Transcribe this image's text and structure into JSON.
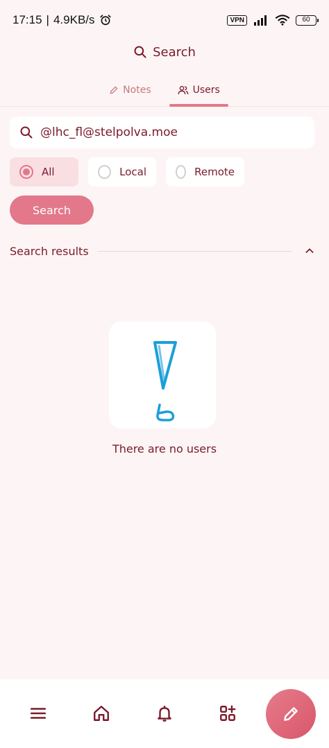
{
  "status_bar": {
    "time": "17:15",
    "separator": "|",
    "net_speed": "4.9KB/s",
    "vpn": "VPN",
    "battery": "60"
  },
  "header": {
    "title": "Search",
    "icon": "search-icon"
  },
  "tabs": [
    {
      "label": "Notes",
      "icon": "pencil-icon",
      "active": false
    },
    {
      "label": "Users",
      "icon": "users-icon",
      "active": true
    }
  ],
  "search": {
    "value": "@lhc_fl@stelpolva.moe",
    "icon": "search-icon"
  },
  "filters": [
    {
      "label": "All",
      "selected": true
    },
    {
      "label": "Local",
      "selected": false
    },
    {
      "label": "Remote",
      "selected": false
    }
  ],
  "search_button": {
    "label": "Search"
  },
  "results": {
    "title": "Search results",
    "collapse_icon": "chevron-up-icon"
  },
  "empty_state": {
    "message": "There are no users",
    "illustration": "exclamation-illustration"
  },
  "bottom_nav": {
    "items": [
      "menu-icon",
      "home-icon",
      "bell-icon",
      "widgets-icon"
    ],
    "fab_icon": "pencil-icon"
  },
  "colors": {
    "accent": "#e3788a",
    "text": "#7a1a2a",
    "background": "#fdf5f5",
    "illustration": "#1a9fd9"
  }
}
